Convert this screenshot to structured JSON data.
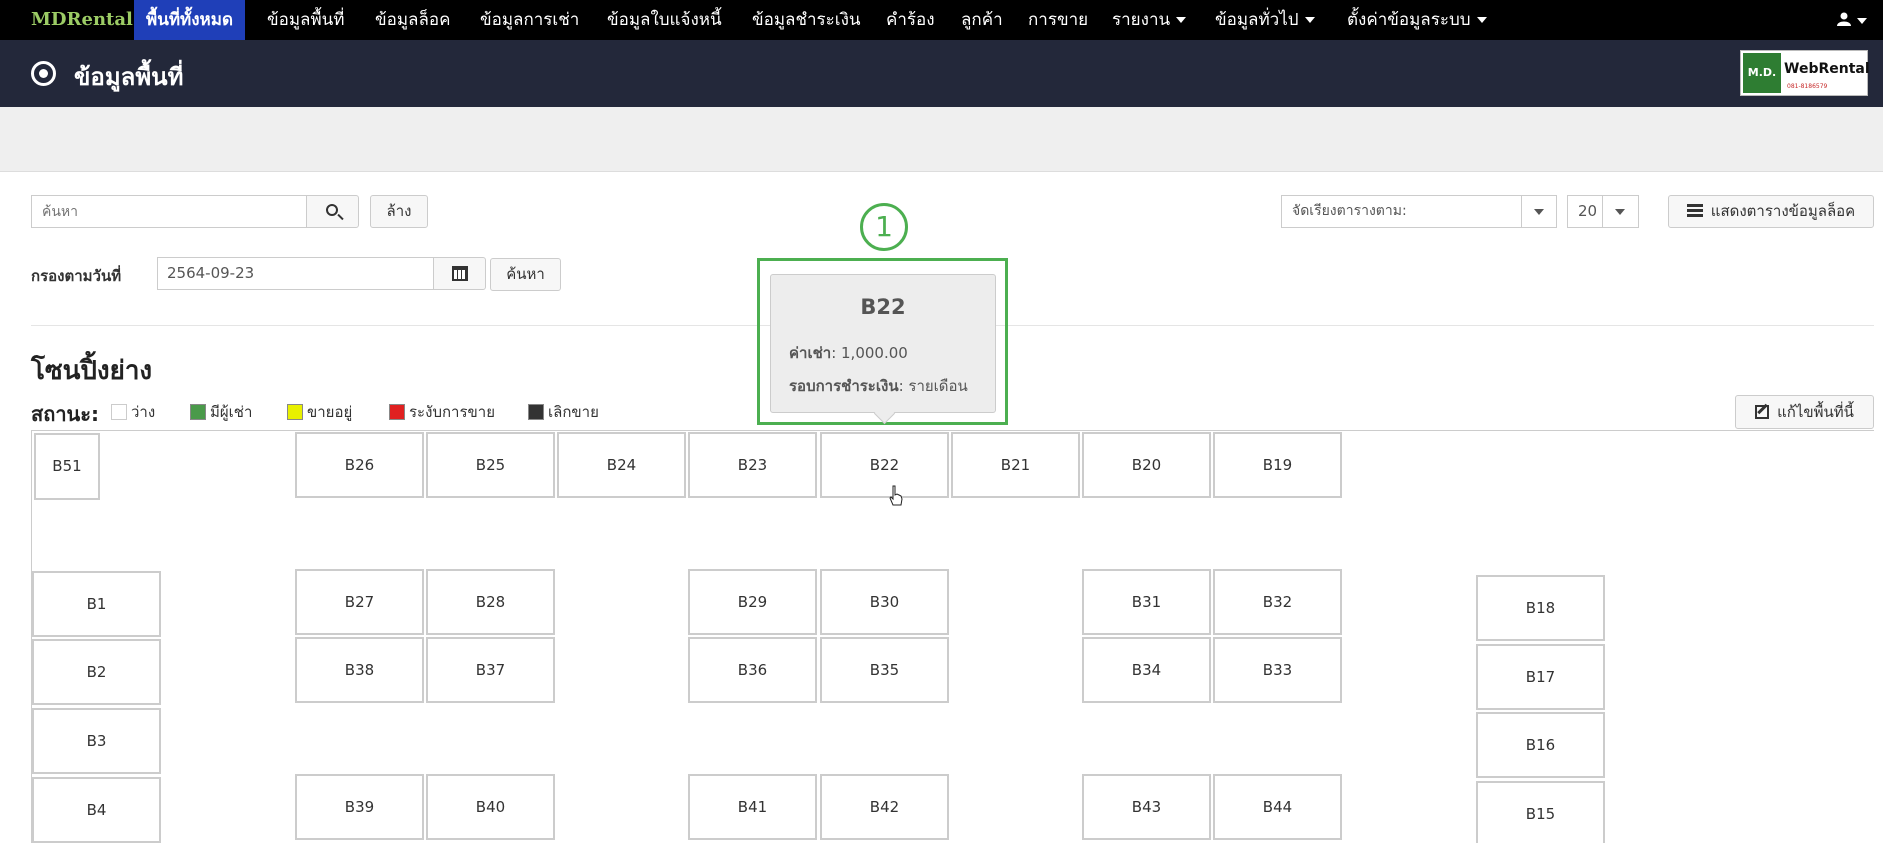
{
  "nav": {
    "brand": "MDRental",
    "items": [
      {
        "label": "พื้นที่ทั้งหมด",
        "active": true
      },
      {
        "label": "ข้อมูลพื้นที่"
      },
      {
        "label": "ข้อมูลล็อค"
      },
      {
        "label": "ข้อมูลการเช่า"
      },
      {
        "label": "ข้อมูลใบแจ้งหนี้"
      },
      {
        "label": "ข้อมูลชำระเงิน"
      },
      {
        "label": "คำร้อง"
      },
      {
        "label": "ลูกค้า"
      },
      {
        "label": "การขาย"
      },
      {
        "label": "รายงาน"
      },
      {
        "label": "ข้อมูลทั่วไป"
      },
      {
        "label": "ตั้งค่าข้อมูลระบบ"
      }
    ],
    "user_icon": "user-icon"
  },
  "header": {
    "title": "ข้อมูลพื้นที่",
    "logo": {
      "md": "M.D.",
      "web": "WebRental",
      "sub": "081-8186579"
    }
  },
  "search": {
    "placeholder": "ค้นหา",
    "clear_label": "ล้าง",
    "sort_label": "จัดเรียงตารางตาม:",
    "page_size": "20",
    "show_lock_label": "แสดงตารางข้อมูลล็อค"
  },
  "filter": {
    "label": "กรองตามวันที่",
    "date": "2564-09-23",
    "find_label": "ค้นหา"
  },
  "zone": {
    "title": "โซนปิ้งย่าง",
    "status_label": "สถานะ:",
    "legend": [
      {
        "label": "ว่าง",
        "color": "#ffffff"
      },
      {
        "label": "มีผู้เช่า",
        "color": "#4a9a4a"
      },
      {
        "label": "ขายอยู่",
        "color": "#e8f000"
      },
      {
        "label": "ระงับการขาย",
        "color": "#e02020"
      },
      {
        "label": "เลิกขาย",
        "color": "#333333"
      }
    ],
    "edit_label": "แก้ไขพื้นที่นี้"
  },
  "slots": {
    "B51": "B51",
    "B26": "B26",
    "B25": "B25",
    "B24": "B24",
    "B23": "B23",
    "B22": "B22",
    "B21": "B21",
    "B20": "B20",
    "B19": "B19",
    "B1": "B1",
    "B2": "B2",
    "B3": "B3",
    "B4": "B4",
    "B27": "B27",
    "B28": "B28",
    "B29": "B29",
    "B30": "B30",
    "B31": "B31",
    "B32": "B32",
    "B38": "B38",
    "B37": "B37",
    "B36": "B36",
    "B35": "B35",
    "B34": "B34",
    "B33": "B33",
    "B39": "B39",
    "B40": "B40",
    "B41": "B41",
    "B42": "B42",
    "B43": "B43",
    "B44": "B44",
    "B18": "B18",
    "B17": "B17",
    "B16": "B16",
    "B15": "B15"
  },
  "tooltip": {
    "annotation_number": "1",
    "title": "B22",
    "rent_label": "ค่าเช่า",
    "rent_value": ": 1,000.00",
    "cycle_label": "รอบการชำระเงิน",
    "cycle_value": ": รายเดือน"
  }
}
